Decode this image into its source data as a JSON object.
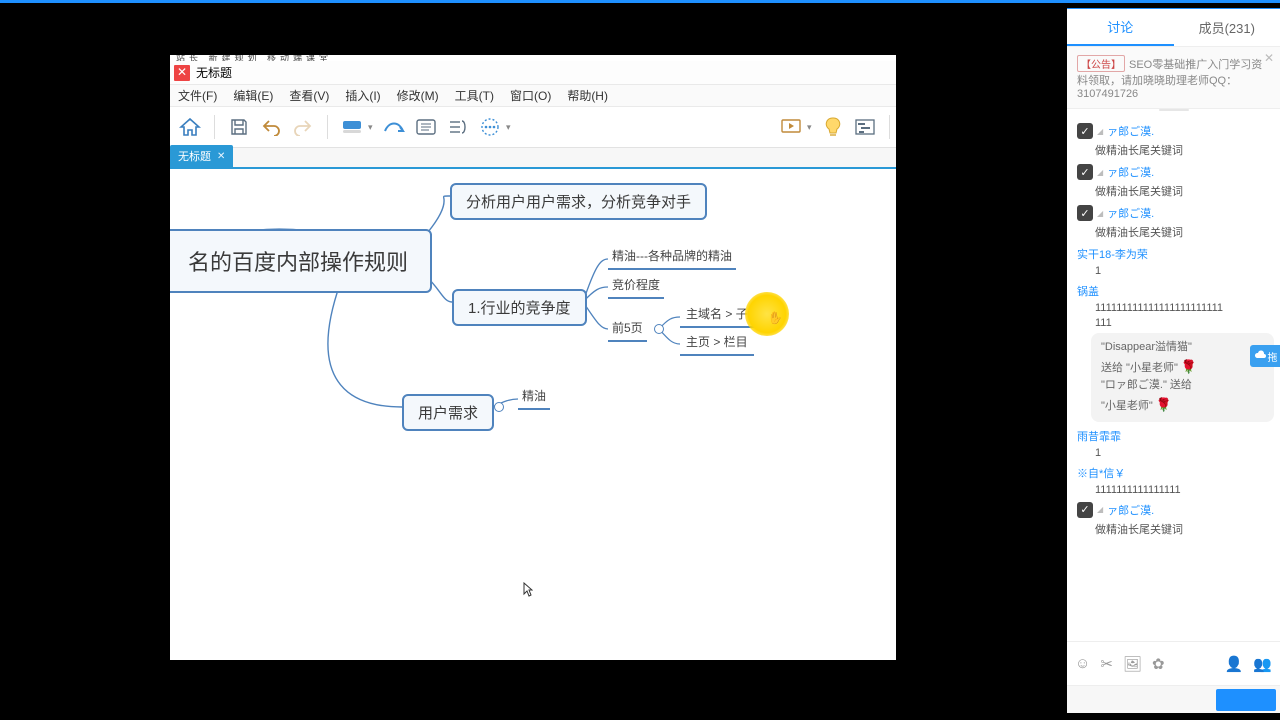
{
  "xmind": {
    "peek": "站长   新建规划   移动端课堂",
    "title": "无标题",
    "menu": {
      "file": "文件(F)",
      "edit": "编辑(E)",
      "view": "查看(V)",
      "insert": "插入(I)",
      "modify": "修改(M)",
      "tools": "工具(T)",
      "window": "窗口(O)",
      "help": "帮助(H)"
    },
    "tab_label": "无标题",
    "nodes": {
      "root": "名的百度内部操作规则",
      "top": "分析用户用户需求，分析竞争对手",
      "industry": "1.行业的竞争度",
      "user_need": "用户需求",
      "l_brand": "精油---各种品牌的精油",
      "l_bid": "竞价程度",
      "l_top5": "前5页",
      "l_domain": "主域名 > 子域名",
      "l_home": "主页 > 栏目",
      "l_jy": "精油"
    }
  },
  "chat": {
    "tabs": {
      "discuss": "讨论",
      "members": "成员(231)"
    },
    "announce": {
      "tag": "【公告】",
      "text": "SEO零基础推广入门学习资料领取，请加晓晓助理老师QQ：3107491726"
    },
    "cloud_badge": "拖",
    "items": [
      {
        "type": "check",
        "user": "ァ郎ご漠.",
        "text": "做精油长尾关键词"
      },
      {
        "type": "check",
        "user": "ァ郎ご漠.",
        "text": "做精油长尾关键词"
      },
      {
        "type": "check",
        "user": "ァ郎ご漠.",
        "text": "做精油长尾关键词"
      },
      {
        "type": "plain",
        "user": "实干18-李为荣",
        "text": "1"
      },
      {
        "type": "plain",
        "user": "锅盖",
        "text": "111111111111111111111111"
      },
      {
        "type": "raw",
        "text": "111"
      },
      {
        "type": "gift",
        "lines": [
          "\"Disappear溢情猫\"",
          "送给 \"小星老师\" 🌹",
          "\"ロァ郎ご漠.\" 送给",
          "\"小星老师\" 🌹"
        ]
      },
      {
        "type": "plain",
        "user": "雨昔霏霏",
        "text": "1"
      },
      {
        "type": "plain",
        "user": "※自*信￥",
        "text": "1111111111111111"
      },
      {
        "type": "check",
        "user": "ァ郎ご漠.",
        "text": "做精油长尾关键词"
      }
    ]
  }
}
